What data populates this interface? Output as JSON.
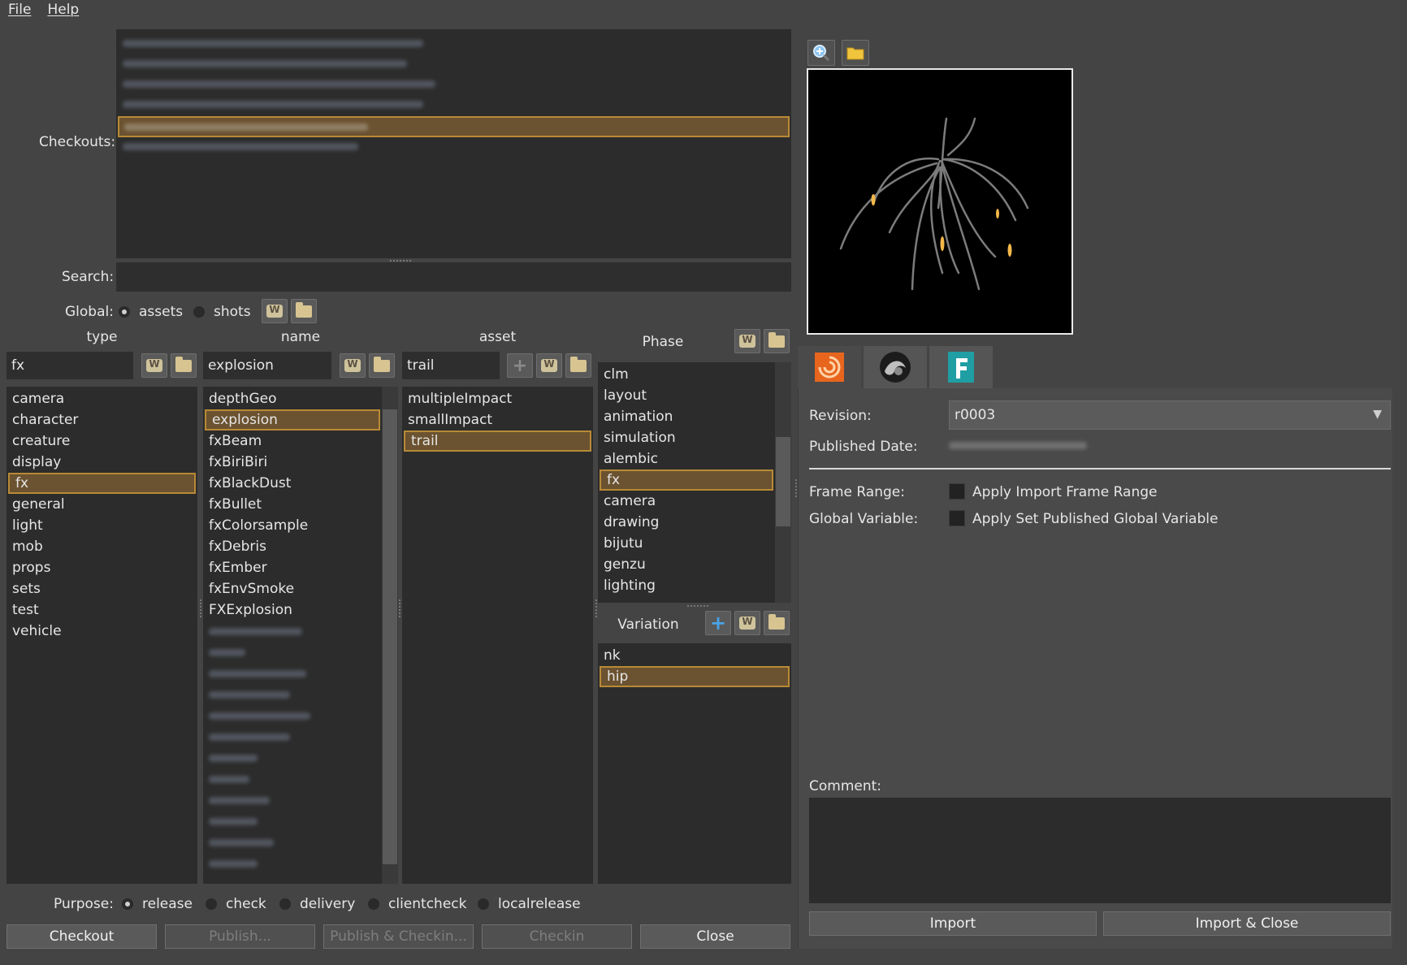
{
  "menu": {
    "file": "File",
    "help": "Help"
  },
  "labels": {
    "checkouts": "Checkouts:",
    "search": "Search:",
    "global": "Global:",
    "purpose": "Purpose:"
  },
  "global_options": [
    {
      "label": "assets",
      "selected": true
    },
    {
      "label": "shots",
      "selected": false
    }
  ],
  "columns": {
    "type": {
      "header": "type",
      "filter": "fx",
      "items": [
        "camera",
        "character",
        "creature",
        "display",
        "fx",
        "general",
        "light",
        "mob",
        "props",
        "sets",
        "test",
        "vehicle"
      ],
      "selected_index": 4
    },
    "name": {
      "header": "name",
      "filter": "explosion",
      "items": [
        "depthGeo",
        "explosion",
        "fxBeam",
        "fxBiriBiri",
        "fxBlackDust",
        "fxBullet",
        "fxColorsample",
        "fxDebris",
        "fxEmber",
        "fxEnvSmoke",
        "FXExplosion"
      ],
      "selected_index": 1
    },
    "asset": {
      "header": "asset",
      "filter": "trail",
      "items": [
        "multipleImpact",
        "smallImpact",
        "trail"
      ],
      "selected_index": 2
    },
    "phase": {
      "header": "Phase",
      "items": [
        "clm",
        "layout",
        "animation",
        "simulation",
        "alembic",
        "fx",
        "camera",
        "drawing",
        "bijutu",
        "genzu",
        "lighting"
      ],
      "selected_index": 5
    },
    "variation": {
      "header": "Variation",
      "items": [
        "nk",
        "hip"
      ],
      "selected_index": 1
    }
  },
  "purpose_options": [
    {
      "label": "release",
      "selected": true
    },
    {
      "label": "check",
      "selected": false
    },
    {
      "label": "delivery",
      "selected": false
    },
    {
      "label": "clientcheck",
      "selected": false
    },
    {
      "label": "localrelease",
      "selected": false
    }
  ],
  "buttons": {
    "checkout": "Checkout",
    "publish": "Publish...",
    "publish_checkin": "Publish & Checkin...",
    "checkin": "Checkin",
    "close": "Close",
    "import": "Import",
    "import_close": "Import & Close"
  },
  "details": {
    "revision_label": "Revision:",
    "revision_value": "r0003",
    "published_date_label": "Published Date:",
    "frame_range_label": "Frame Range:",
    "frame_range_option": "Apply Import Frame Range",
    "global_variable_label": "Global Variable:",
    "global_variable_option": "Apply Set Published Global Variable",
    "comment_label": "Comment:"
  },
  "app_tabs": [
    "houdini-icon",
    "maya-icon",
    "fusion-icon"
  ],
  "colors": {
    "selection_fill": "#6b5230",
    "selection_border": "#b88a36",
    "background": "#444444",
    "list_bg": "#2c2c2c"
  }
}
